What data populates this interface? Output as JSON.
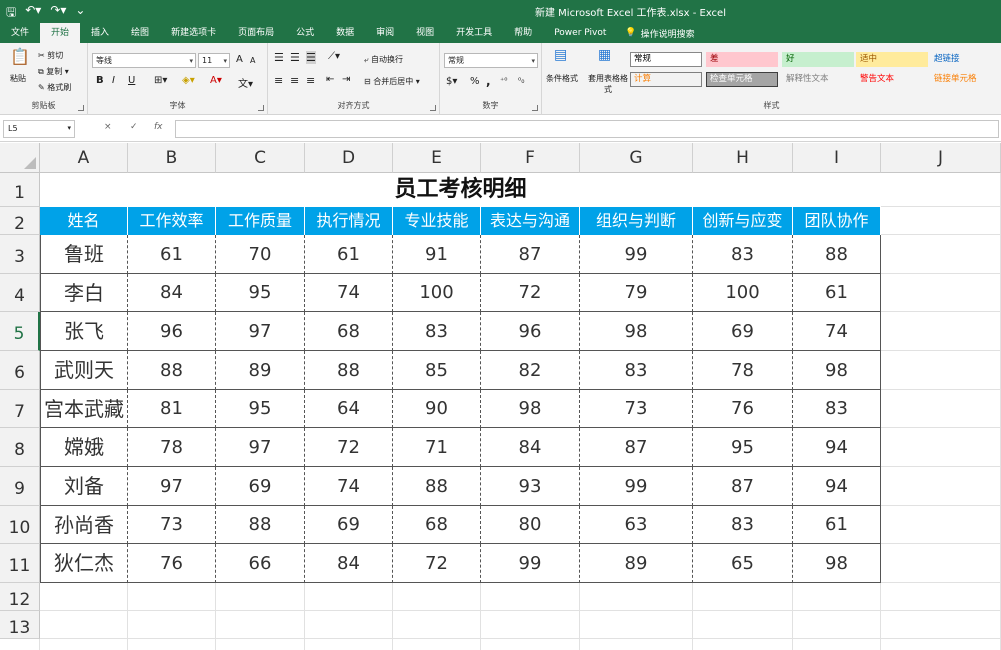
{
  "window": {
    "title": "新建 Microsoft Excel 工作表.xlsx  -  Excel"
  },
  "tabs": [
    "文件",
    "开始",
    "插入",
    "绘图",
    "新建选项卡",
    "页面布局",
    "公式",
    "数据",
    "审阅",
    "视图",
    "开发工具",
    "帮助",
    "Power Pivot"
  ],
  "tell_me": "操作说明搜索",
  "ribbon": {
    "clipboard": {
      "paste": "粘贴",
      "cut": "剪切",
      "copy": "复制 ▾",
      "format_painter": "格式刷",
      "label": "剪贴板"
    },
    "font": {
      "name": "等线",
      "size": "11",
      "label": "字体",
      "bold": "B",
      "italic": "I",
      "underline": "U",
      "grow": "A",
      "shrink": "A"
    },
    "alignment": {
      "wrap": "自动换行",
      "merge": "合并后居中 ▾",
      "label": "对齐方式"
    },
    "number": {
      "format": "常规",
      "label": "数字",
      "percent": "%",
      "comma": ","
    },
    "styles": {
      "cond_format": "条件格式",
      "table_format": "套用表格格式",
      "label": "样式",
      "cells": [
        {
          "text": "常规",
          "bg": "#ffffff",
          "color": "#000000",
          "border": "#888888"
        },
        {
          "text": "差",
          "bg": "#ffc7ce",
          "color": "#9c0006",
          "border": "#ffc7ce"
        },
        {
          "text": "好",
          "bg": "#c6efce",
          "color": "#006100",
          "border": "#c6efce"
        },
        {
          "text": "适中",
          "bg": "#ffeb9c",
          "color": "#9c5700",
          "border": "#ffeb9c"
        },
        {
          "text": "超链接",
          "bg": "#f3f3f3",
          "color": "#0563c1",
          "border": "#f3f3f3"
        },
        {
          "text": "计算",
          "bg": "#f2f2f2",
          "color": "#fa7d00",
          "border": "#7f7f7f"
        },
        {
          "text": "检查单元格",
          "bg": "#a5a5a5",
          "color": "#ffffff",
          "border": "#3f3f3f"
        },
        {
          "text": "解释性文本",
          "bg": "#f3f3f3",
          "color": "#7f7f7f",
          "border": "#f3f3f3"
        },
        {
          "text": "警告文本",
          "bg": "#f3f3f3",
          "color": "#ff0000",
          "border": "#f3f3f3"
        },
        {
          "text": "链接单元格",
          "bg": "#f3f3f3",
          "color": "#fa7d00",
          "border": "#f3f3f3"
        }
      ]
    }
  },
  "formula_bar": {
    "name_box": "L5",
    "cancel": "×",
    "enter": "✓",
    "fx": "fx"
  },
  "columns": [
    "A",
    "B",
    "C",
    "D",
    "E",
    "F",
    "G",
    "H",
    "I",
    "J"
  ],
  "rows": [
    "1",
    "2",
    "3",
    "4",
    "5",
    "6",
    "7",
    "8",
    "9",
    "10",
    "11",
    "12",
    "13"
  ],
  "selected_row": "5",
  "sheet": {
    "title": "员工考核明细",
    "headers": [
      "姓名",
      "工作效率",
      "工作质量",
      "执行情况",
      "专业技能",
      "表达与沟通",
      "组织与判断",
      "创新与应变",
      "团队协作"
    ],
    "records": [
      [
        "鲁班",
        "61",
        "70",
        "61",
        "91",
        "87",
        "99",
        "83",
        "88"
      ],
      [
        "李白",
        "84",
        "95",
        "74",
        "100",
        "72",
        "79",
        "100",
        "61"
      ],
      [
        "张飞",
        "96",
        "97",
        "68",
        "83",
        "96",
        "98",
        "69",
        "74"
      ],
      [
        "武则天",
        "88",
        "89",
        "88",
        "85",
        "82",
        "83",
        "78",
        "98"
      ],
      [
        "宫本武藏",
        "81",
        "95",
        "64",
        "90",
        "98",
        "73",
        "76",
        "83"
      ],
      [
        "嫦娥",
        "78",
        "97",
        "72",
        "71",
        "84",
        "87",
        "95",
        "94"
      ],
      [
        "刘备",
        "97",
        "69",
        "74",
        "88",
        "93",
        "99",
        "87",
        "94"
      ],
      [
        "孙尚香",
        "73",
        "88",
        "69",
        "68",
        "80",
        "63",
        "83",
        "61"
      ],
      [
        "狄仁杰",
        "76",
        "66",
        "84",
        "72",
        "99",
        "89",
        "65",
        "98"
      ]
    ]
  },
  "colors": {
    "accent": "#217346",
    "header_fill": "#00a2e8"
  }
}
